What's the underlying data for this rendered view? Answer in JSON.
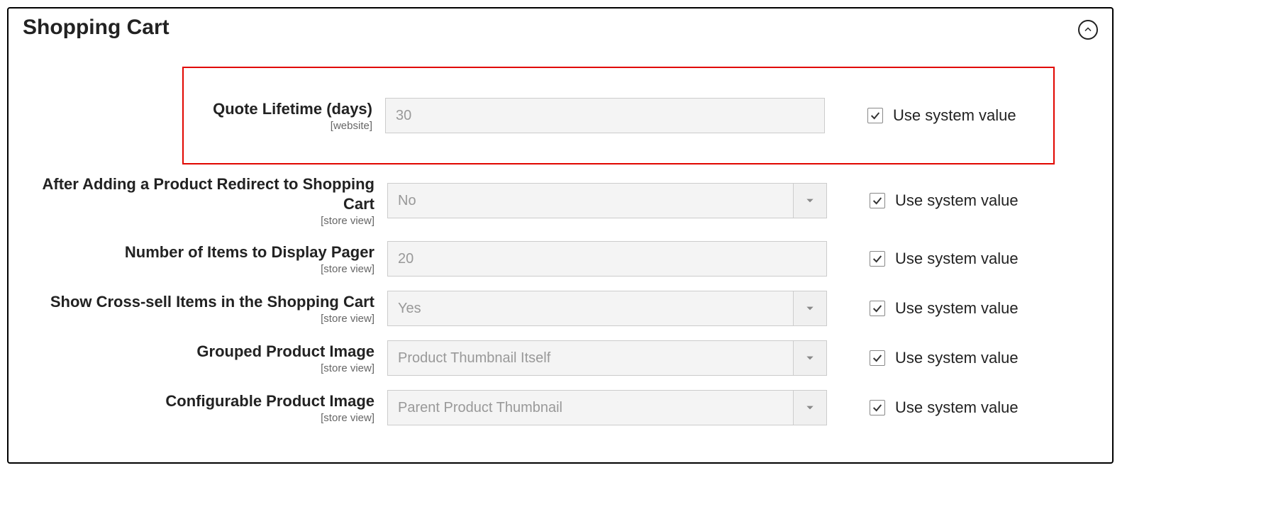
{
  "section": {
    "title": "Shopping Cart",
    "use_system_label": "Use system value"
  },
  "fields": {
    "quote_lifetime": {
      "label": "Quote Lifetime (days)",
      "scope": "[website]",
      "value": "30",
      "use_system": true,
      "type": "text"
    },
    "redirect_after_add": {
      "label": "After Adding a Product Redirect to Shopping Cart",
      "scope": "[store view]",
      "value": "No",
      "use_system": true,
      "type": "select"
    },
    "items_pager": {
      "label": "Number of Items to Display Pager",
      "scope": "[store view]",
      "value": "20",
      "use_system": true,
      "type": "text"
    },
    "cross_sell": {
      "label": "Show Cross-sell Items in the Shopping Cart",
      "scope": "[store view]",
      "value": "Yes",
      "use_system": true,
      "type": "select"
    },
    "grouped_image": {
      "label": "Grouped Product Image",
      "scope": "[store view]",
      "value": "Product Thumbnail Itself",
      "use_system": true,
      "type": "select"
    },
    "configurable_image": {
      "label": "Configurable Product Image",
      "scope": "[store view]",
      "value": "Parent Product Thumbnail",
      "use_system": true,
      "type": "select"
    }
  }
}
